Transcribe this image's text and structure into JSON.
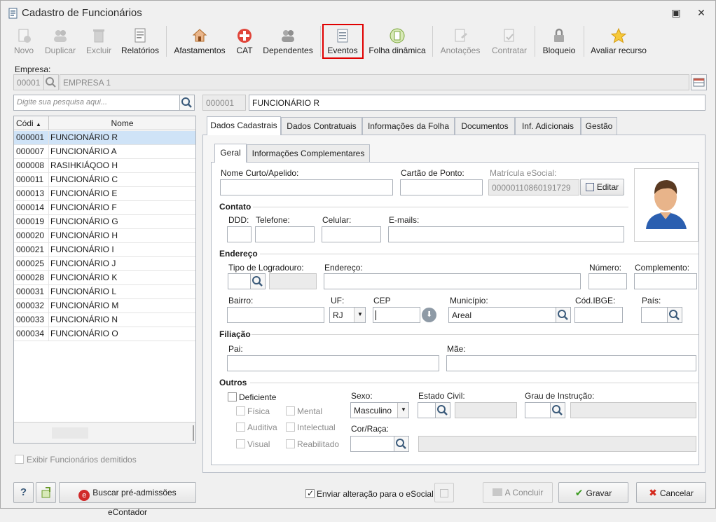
{
  "window": {
    "title": "Cadastro de Funcionários"
  },
  "toolbar": {
    "novo": "Novo",
    "duplicar": "Duplicar",
    "excluir": "Excluir",
    "relatorios": "Relatórios",
    "afastamentos": "Afastamentos",
    "cat": "CAT",
    "dependentes": "Dependentes",
    "eventos": "Eventos",
    "folha_dinamica": "Folha dinâmica",
    "anotacoes": "Anotações",
    "contratar": "Contratar",
    "bloqueio": "Bloqueio",
    "avaliar": "Avaliar recurso"
  },
  "empresa": {
    "label": "Empresa:",
    "code": "00001",
    "name": "EMPRESA 1"
  },
  "search": {
    "placeholder": "Digite sua pesquisa aqui..."
  },
  "employee": {
    "code": "000001",
    "name": "FUNCIONÁRIO R"
  },
  "grid": {
    "col_code": "Códi",
    "col_name": "Nome",
    "rows": [
      {
        "code": "000001",
        "name": "FUNCIONÁRIO R"
      },
      {
        "code": "000007",
        "name": "FUNCIONÁRIO A"
      },
      {
        "code": "000008",
        "name": "RASIHKIÁQOO H"
      },
      {
        "code": "000011",
        "name": "FUNCIONÁRIO C"
      },
      {
        "code": "000013",
        "name": "FUNCIONÁRIO E"
      },
      {
        "code": "000014",
        "name": "FUNCIONÁRIO F"
      },
      {
        "code": "000019",
        "name": "FUNCIONÁRIO G"
      },
      {
        "code": "000020",
        "name": "FUNCIONÁRIO H"
      },
      {
        "code": "000021",
        "name": "FUNCIONÁRIO I"
      },
      {
        "code": "000025",
        "name": "FUNCIONÁRIO J"
      },
      {
        "code": "000028",
        "name": "FUNCIONÁRIO K"
      },
      {
        "code": "000031",
        "name": "FUNCIONÁRIO L"
      },
      {
        "code": "000032",
        "name": "FUNCIONÁRIO M"
      },
      {
        "code": "000033",
        "name": "FUNCIONÁRIO N"
      },
      {
        "code": "000034",
        "name": "FUNCIONÁRIO O"
      }
    ]
  },
  "exibir_demitidos": "Exibir Funcionários demitidos",
  "tabs": {
    "main": [
      "Dados Cadastrais",
      "Dados Contratuais",
      "Informações da Folha",
      "Documentos",
      "Inf. Adicionais",
      "Gestão"
    ],
    "sub": [
      "Geral",
      "Informações Complementares"
    ]
  },
  "form": {
    "nome_curto": "Nome Curto/Apelido:",
    "cartao_ponto": "Cartão de Ponto:",
    "matricula_label": "Matrícula eSocial:",
    "matricula_value": "00000110860191729",
    "editar": "Editar",
    "contato": "Contato",
    "ddd": "DDD:",
    "telefone": "Telefone:",
    "celular": "Celular:",
    "emails": "E-mails:",
    "endereco_sec": "Endereço",
    "tipo_logradouro": "Tipo de Logradouro:",
    "endereco": "Endereço:",
    "numero": "Número:",
    "complemento": "Complemento:",
    "bairro": "Bairro:",
    "uf": "UF:",
    "uf_value": "RJ",
    "cep": "CEP",
    "municipio": "Município:",
    "municipio_value": "Areal",
    "cod_ibge": "Cód.IBGE:",
    "pais": "País:",
    "filiacao": "Filiação",
    "pai": "Pai:",
    "mae": "Mãe:",
    "outros": "Outros",
    "deficiente": "Deficiente",
    "fisica": "Física",
    "mental": "Mental",
    "auditiva": "Auditiva",
    "intelectual": "Intelectual",
    "visual": "Visual",
    "reabilitado": "Reabilitado",
    "sexo": "Sexo:",
    "sexo_value": "Masculino",
    "estado_civil": "Estado Civil:",
    "grau_instrucao": "Grau de Instrução:",
    "cor_raca": "Cor/Raça:"
  },
  "bottom": {
    "buscar": "Buscar pré-admissões eContador",
    "enviar": "Enviar alteração para o eSocial",
    "concluir": "A Concluir",
    "gravar": "Gravar",
    "cancelar": "Cancelar"
  },
  "colors": {
    "highlight": "#e00000",
    "selection": "#cfe3f7",
    "gravar": "#3a9a1e",
    "cancelar": "#d42a1e"
  }
}
